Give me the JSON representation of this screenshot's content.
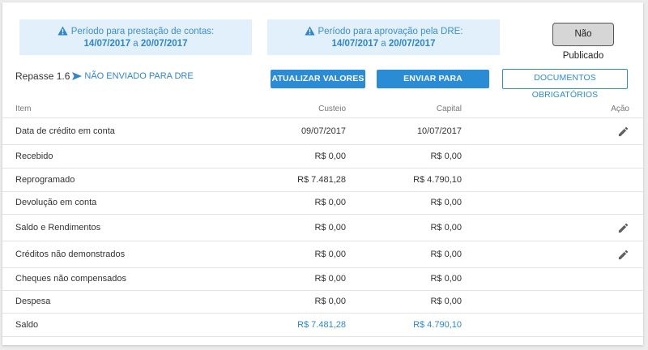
{
  "banners": [
    {
      "label": "Período para prestação de contas:",
      "start": "14/07/2017",
      "connector": "a",
      "end": "20/07/2017"
    },
    {
      "label": "Período para aprovação pela DRE:",
      "start": "14/07/2017",
      "connector": "a",
      "end": "20/07/2017"
    }
  ],
  "status_badge": "Não Publicado",
  "repasse": {
    "label": "Repasse 1.6",
    "status": "NÃO ENVIADO PARA DRE"
  },
  "buttons": {
    "update": "ATUALIZAR VALORES",
    "send": "ENVIAR PARA APROVAÇÃO",
    "docs": "DOCUMENTOS OBRIGATÓRIOS"
  },
  "table": {
    "headers": {
      "item": "Item",
      "custeio": "Custeio",
      "capital": "Capital",
      "acao": "Ação"
    },
    "rows": [
      {
        "item": "Data de crédito em conta",
        "custeio": "09/07/2017",
        "capital": "10/07/2017",
        "editable": true
      },
      {
        "item": "Recebido",
        "custeio": "R$ 0,00",
        "capital": "R$ 0,00",
        "editable": false
      },
      {
        "item": "Reprogramado",
        "custeio": "R$ 7.481,28",
        "capital": "R$ 4.790,10",
        "editable": false
      },
      {
        "item": "Devolução em conta",
        "custeio": "R$ 0,00",
        "capital": "R$ 0,00",
        "editable": false
      },
      {
        "item": "Saldo e Rendimentos",
        "custeio": "R$ 0,00",
        "capital": "R$ 0,00",
        "editable": true
      },
      {
        "item": "Créditos não demonstrados",
        "custeio": "R$ 0,00",
        "capital": "R$ 0,00",
        "editable": true
      },
      {
        "item": "Cheques não compensados",
        "custeio": "R$ 0,00",
        "capital": "R$ 0,00",
        "editable": false
      },
      {
        "item": "Despesa",
        "custeio": "R$ 0,00",
        "capital": "R$ 0,00",
        "editable": false
      },
      {
        "item": "Saldo",
        "custeio": "R$ 7.481,28",
        "capital": "R$ 4.790,10",
        "editable": false
      }
    ]
  },
  "colors": {
    "accent": "#2b8cd6",
    "banner_bg": "#e1f0fb"
  },
  "icons": {
    "warning": "warning-icon",
    "edit": "pencil-icon",
    "arrow": "send-arrow-icon"
  }
}
